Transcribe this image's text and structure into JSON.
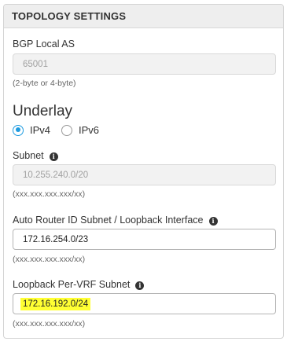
{
  "panel": {
    "title": "TOPOLOGY SETTINGS"
  },
  "bgp": {
    "label": "BGP Local AS",
    "value": "65001",
    "hint": "(2-byte or 4-byte)"
  },
  "underlay": {
    "heading": "Underlay",
    "options": [
      {
        "label": "IPv4",
        "selected": true
      },
      {
        "label": "IPv6",
        "selected": false
      }
    ]
  },
  "subnet": {
    "label": "Subnet",
    "value": "10.255.240.0/20",
    "hint": "(xxx.xxx.xxx.xxx/xx)"
  },
  "router_id": {
    "label": "Auto Router ID Subnet / Loopback Interface",
    "value": "172.16.254.0/23",
    "hint": "(xxx.xxx.xxx.xxx/xx)"
  },
  "loopback_vrf": {
    "label": "Loopback Per-VRF Subnet",
    "value": "172.16.192.0/24",
    "hint": "(xxx.xxx.xxx.xxx/xx)"
  },
  "icons": {
    "info": "info-circle-icon",
    "info_glyph": "i"
  },
  "colors": {
    "accent": "#1e9be0",
    "highlight": "#ffff33",
    "header_bg": "#eeeeee",
    "disabled_bg": "#f2f2f2"
  }
}
